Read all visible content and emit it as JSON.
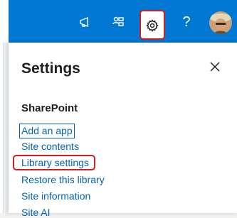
{
  "topbar": {
    "icons": [
      "megaphone-icon",
      "notes-icon",
      "gear-icon",
      "help-icon"
    ],
    "help_label": "?",
    "accent_color": "#0078d4"
  },
  "settings_panel": {
    "title": "Settings",
    "close_icon": "close-icon",
    "section_title": "SharePoint",
    "links": [
      "Add an app",
      "Site contents",
      "Library settings",
      "Restore this library",
      "Site information",
      "Site AI"
    ],
    "focused_link_index": 0,
    "highlighted_link_index": 2,
    "highlight_color": "#d71b1b"
  }
}
